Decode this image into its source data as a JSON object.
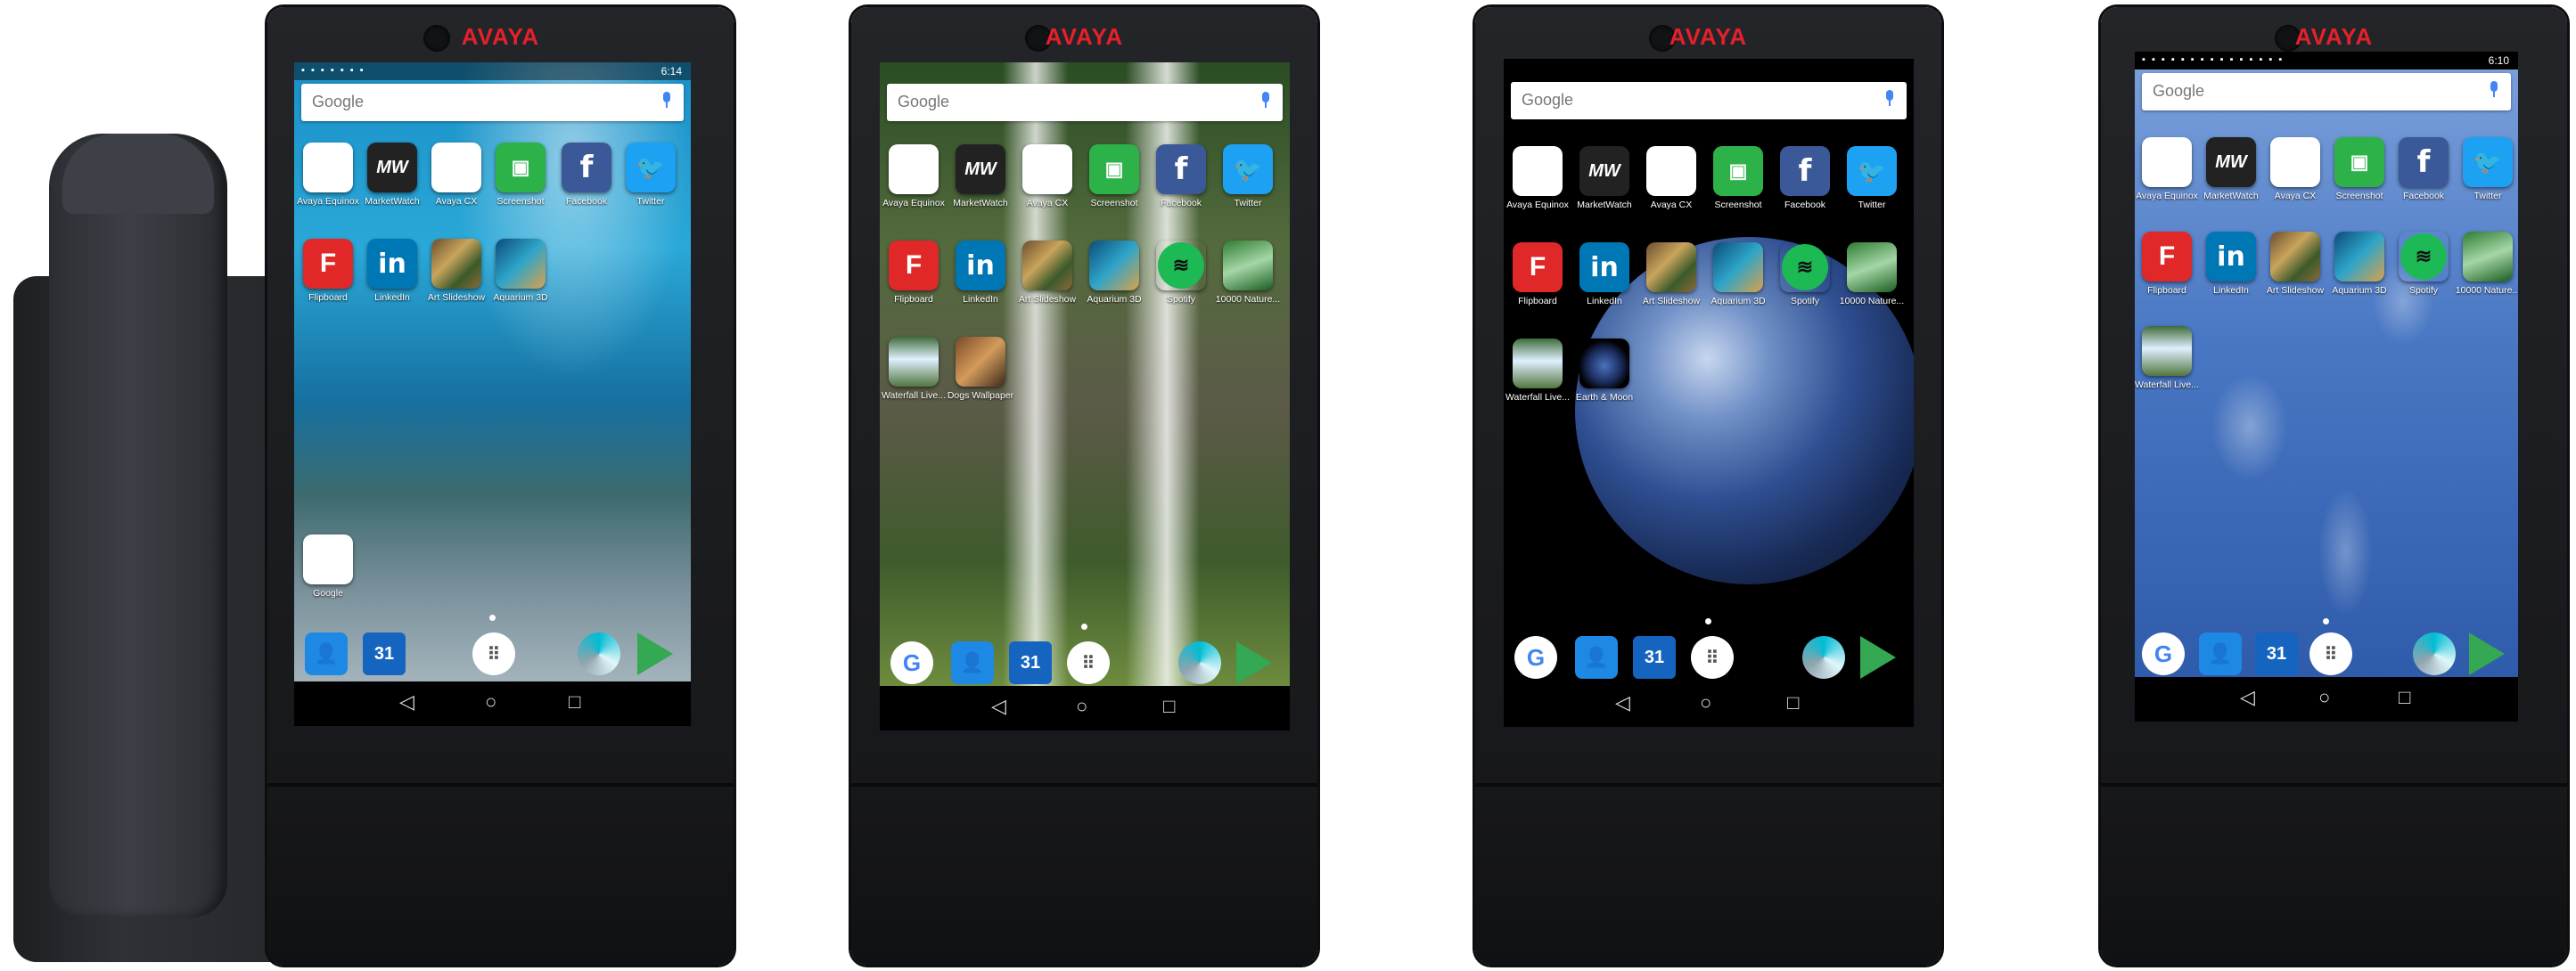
{
  "brand": "AVAYA",
  "search_placeholder": "Google",
  "phones": [
    {
      "status_time": "6:14",
      "apps_row1": [
        "Avaya Equinox",
        "MarketWatch",
        "Avaya CX",
        "Screenshot",
        "Facebook",
        "Twitter"
      ],
      "apps_row2": [
        "Flipboard",
        "LinkedIn",
        "Art Slideshow",
        "Aquarium 3D"
      ],
      "extra_app": "Google"
    },
    {
      "apps_row1": [
        "Avaya Equinox",
        "MarketWatch",
        "Avaya CX",
        "Screenshot",
        "Facebook",
        "Twitter"
      ],
      "apps_row2": [
        "Flipboard",
        "LinkedIn",
        "Art Slideshow",
        "Aquarium 3D",
        "Spotify",
        "10000 Nature..."
      ],
      "apps_row3": [
        "Waterfall Live...",
        "Dogs Wallpaper"
      ]
    },
    {
      "apps_row1": [
        "Avaya Equinox",
        "MarketWatch",
        "Avaya CX",
        "Screenshot",
        "Facebook",
        "Twitter"
      ],
      "apps_row2": [
        "Flipboard",
        "LinkedIn",
        "Art Slideshow",
        "Aquarium 3D",
        "Spotify",
        "10000 Nature..."
      ],
      "apps_row3": [
        "Waterfall Live...",
        "Earth & Moon"
      ]
    },
    {
      "status_time": "6:10",
      "apps_row1": [
        "Avaya Equinox",
        "MarketWatch",
        "Avaya CX",
        "Screenshot",
        "Facebook",
        "Twitter"
      ],
      "apps_row2": [
        "Flipboard",
        "LinkedIn",
        "Art Slideshow",
        "Aquarium 3D",
        "Spotify",
        "10000 Nature..."
      ],
      "apps_row3": [
        "Waterfall Live..."
      ]
    }
  ],
  "icon_glyphs": {
    "equinox": "⚇",
    "marketwatch": "MW",
    "avaya": "AVAYA",
    "screenshot": "▣",
    "facebook": "f",
    "twitter": "🐦",
    "flipboard": "F",
    "linkedin": "in",
    "spotify": "≋",
    "google": "G",
    "contacts": "👤",
    "calendar": "31",
    "app_drawer": "⠿",
    "back": "◁",
    "home": "○",
    "recents": "□"
  }
}
